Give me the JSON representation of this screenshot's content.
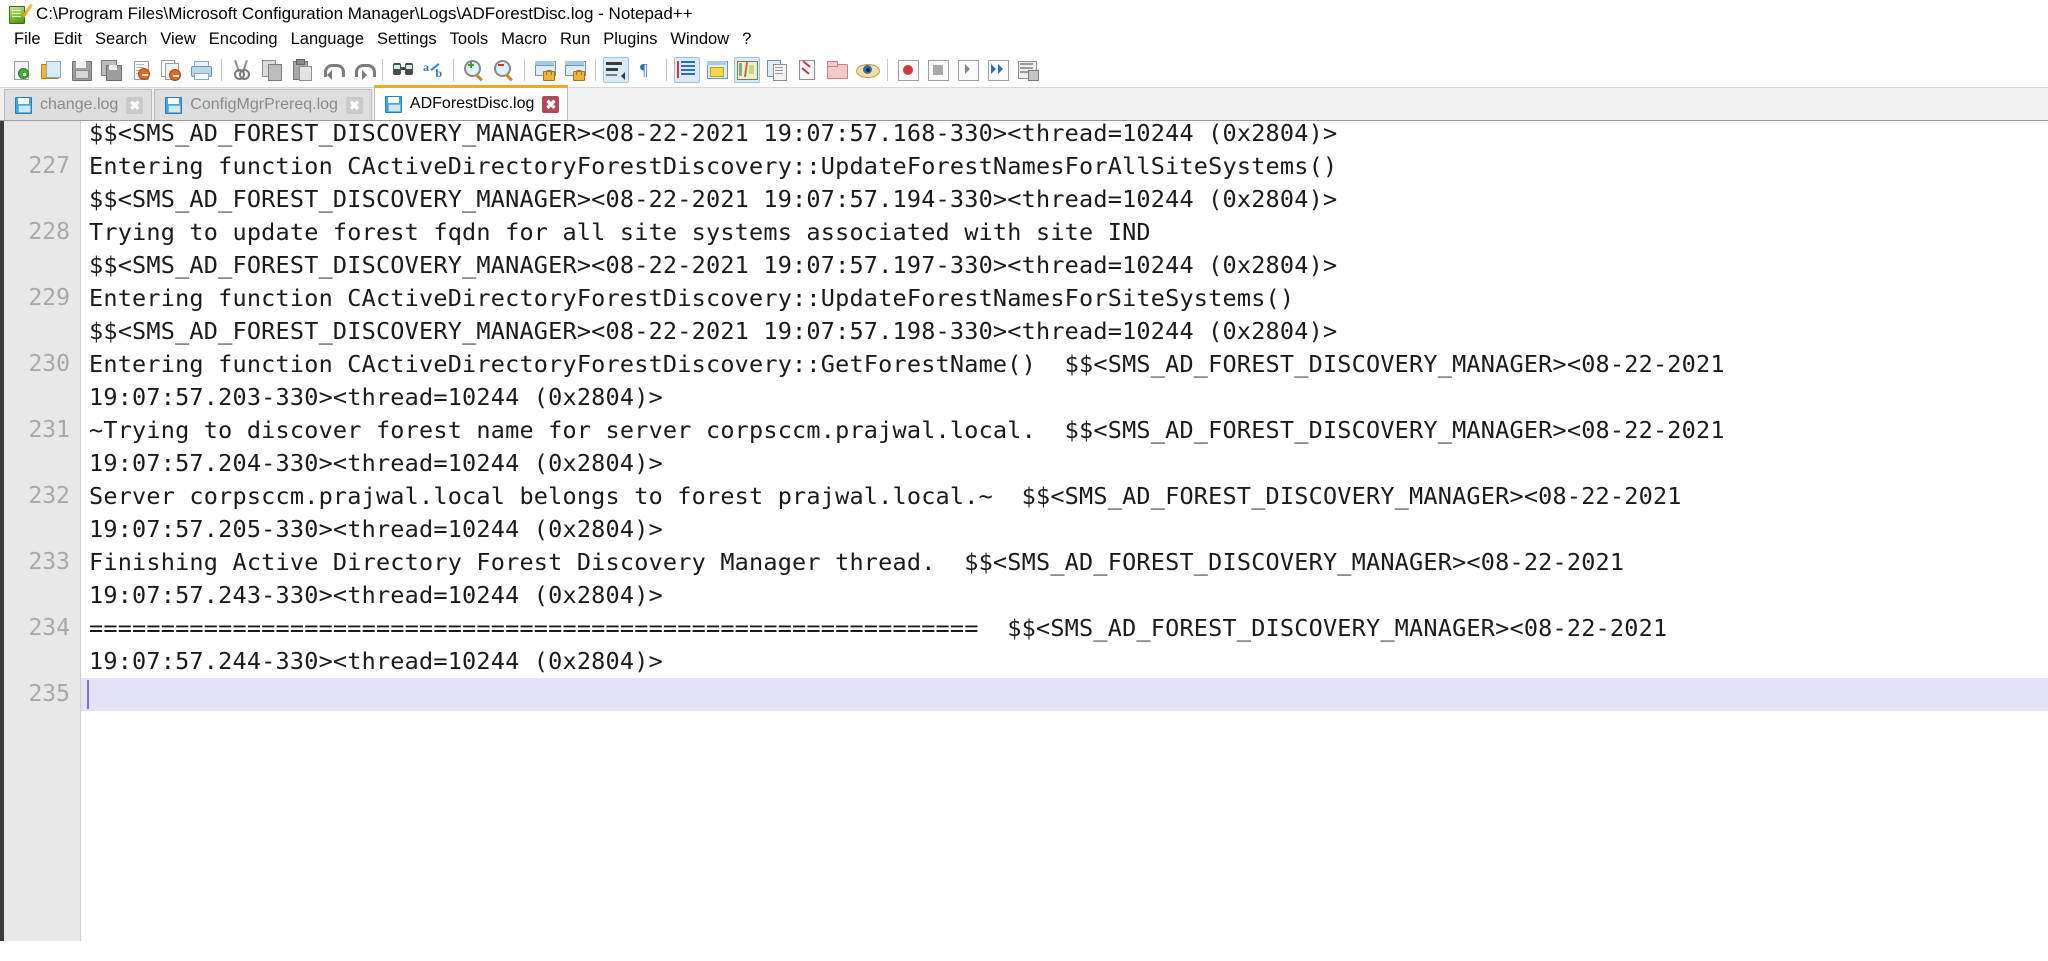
{
  "window": {
    "title": "C:\\Program Files\\Microsoft Configuration Manager\\Logs\\ADForestDisc.log - Notepad++",
    "app_icon": "notepad-plus-plus-icon"
  },
  "menubar": {
    "items": [
      {
        "label": "File"
      },
      {
        "label": "Edit"
      },
      {
        "label": "Search"
      },
      {
        "label": "View"
      },
      {
        "label": "Encoding"
      },
      {
        "label": "Language"
      },
      {
        "label": "Settings"
      },
      {
        "label": "Tools"
      },
      {
        "label": "Macro"
      },
      {
        "label": "Run"
      },
      {
        "label": "Plugins"
      },
      {
        "label": "Window"
      },
      {
        "label": "?"
      }
    ]
  },
  "toolbar": {
    "buttons": [
      {
        "name": "new-file-icon"
      },
      {
        "name": "open-file-icon"
      },
      {
        "name": "save-icon"
      },
      {
        "name": "save-all-icon"
      },
      {
        "name": "close-file-icon"
      },
      {
        "name": "close-all-files-icon"
      },
      {
        "name": "print-icon"
      },
      {
        "sep": true
      },
      {
        "name": "cut-icon"
      },
      {
        "name": "copy-icon"
      },
      {
        "name": "paste-icon"
      },
      {
        "name": "undo-icon"
      },
      {
        "name": "redo-icon"
      },
      {
        "sep": true
      },
      {
        "name": "find-icon"
      },
      {
        "name": "replace-icon"
      },
      {
        "sep": true
      },
      {
        "name": "zoom-in-icon"
      },
      {
        "name": "zoom-out-icon"
      },
      {
        "sep": true
      },
      {
        "name": "sync-vertical-scroll-icon"
      },
      {
        "name": "sync-horizontal-scroll-icon"
      },
      {
        "sep": true
      },
      {
        "name": "word-wrap-icon"
      },
      {
        "name": "show-all-characters-icon"
      },
      {
        "sep": true
      },
      {
        "name": "show-indent-guide-icon"
      },
      {
        "name": "user-defined-language-icon"
      },
      {
        "name": "document-map-icon"
      },
      {
        "name": "function-list-icon"
      },
      {
        "name": "document-list-icon"
      },
      {
        "name": "folder-as-workspace-icon"
      },
      {
        "name": "monitoring-icon"
      },
      {
        "sep": true
      },
      {
        "name": "start-record-macro-icon"
      },
      {
        "name": "stop-record-macro-icon"
      },
      {
        "name": "play-macro-icon"
      },
      {
        "name": "run-macro-multiple-icon"
      },
      {
        "name": "save-current-macro-icon"
      }
    ]
  },
  "tabs": [
    {
      "label": "change.log",
      "active": false,
      "icon": "saved-file-icon",
      "close": "✖"
    },
    {
      "label": "ConfigMgrPrereq.log",
      "active": false,
      "icon": "saved-file-icon",
      "close": "✖"
    },
    {
      "label": "ADForestDisc.log",
      "active": true,
      "icon": "saved-file-icon",
      "close": "✖"
    }
  ],
  "editor": {
    "active_line": 235,
    "caret_line": 235,
    "current_line_highlight_color": "#e4e2f7",
    "caret_color": "#7a6fd0",
    "gutter_color": "#e8e8e8",
    "line_number_color": "#a8a8a8",
    "lines": [
      {
        "number": "",
        "segments": [
          {
            "text": "$$<SMS_AD_FOREST_DISCOVERY_MANAGER><08-22-2021 19:07:57.168-330><thread=10244 (0x2804)>"
          }
        ]
      },
      {
        "number": "227",
        "segments": [
          {
            "text": "Entering function CActiveDirectoryForestDiscovery::UpdateForestNamesForAllSiteSystems()"
          }
        ]
      },
      {
        "number": "",
        "segments": [
          {
            "text": "$$<SMS_AD_FOREST_DISCOVERY_MANAGER><08-22-2021 19:07:57.194-330><thread=10244 (0x2804)>"
          }
        ]
      },
      {
        "number": "228",
        "segments": [
          {
            "text": "Trying to update forest fqdn for all site systems associated with site IND"
          }
        ]
      },
      {
        "number": "",
        "segments": [
          {
            "text": "$$<SMS_AD_FOREST_DISCOVERY_MANAGER><08-22-2021 19:07:57.197-330><thread=10244 (0x2804)>"
          }
        ]
      },
      {
        "number": "229",
        "segments": [
          {
            "text": "Entering function CActiveDirectoryForestDiscovery::UpdateForestNamesForSiteSystems()"
          }
        ]
      },
      {
        "number": "",
        "segments": [
          {
            "text": "$$<SMS_AD_FOREST_DISCOVERY_MANAGER><08-22-2021 19:07:57.198-330><thread=10244 (0x2804)>"
          }
        ]
      },
      {
        "number": "230",
        "segments": [
          {
            "text": "Entering function CActiveDirectoryForestDiscovery::GetForestName()  $$<SMS_AD_FOREST_DISCOVERY_MANAGER><08-22-2021"
          }
        ]
      },
      {
        "number": "",
        "segments": [
          {
            "text": "19:07:57.203-330><thread=10244 (0x2804)>"
          }
        ]
      },
      {
        "number": "231",
        "segments": [
          {
            "text": "~Trying to discover forest name for server corpsccm.prajwal.local.  $$<SMS_AD_FOREST_DISCOVERY_MANAGER><08-22-2021"
          }
        ]
      },
      {
        "number": "",
        "segments": [
          {
            "text": "19:07:57.204-330><thread=10244 (0x2804)>"
          }
        ]
      },
      {
        "number": "232",
        "segments": [
          {
            "text": "Server corpsccm.prajwal.local belongs to forest prajwal.local.~  $$<SMS_AD_FOREST_DISCOVERY_MANAGER><08-22-2021"
          }
        ]
      },
      {
        "number": "",
        "segments": [
          {
            "text": "19:07:57.205-330><thread=10244 (0x2804)>"
          }
        ]
      },
      {
        "number": "233",
        "segments": [
          {
            "text": "Finishing Active Directory Forest Discovery Manager thread.  $$<SMS_AD_FOREST_DISCOVERY_MANAGER><08-22-2021"
          }
        ]
      },
      {
        "number": "",
        "segments": [
          {
            "text": "19:07:57.243-330><thread=10244 (0x2804)>"
          }
        ]
      },
      {
        "number": "234",
        "segments": [
          {
            "text": "==============================================================  $$<SMS_AD_FOREST_DISCOVERY_MANAGER><08-22-2021"
          }
        ]
      },
      {
        "number": "",
        "segments": [
          {
            "text": "19:07:57.244-330><thread=10244 (0x2804)>"
          }
        ]
      },
      {
        "number": "235",
        "segments": [
          {
            "text": ""
          }
        ]
      }
    ]
  }
}
